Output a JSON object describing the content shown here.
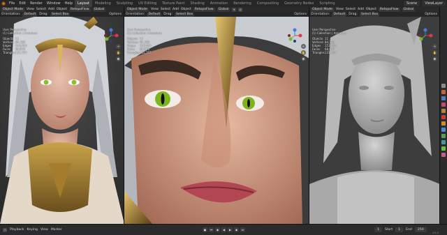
{
  "topbar": {
    "menus": [
      "File",
      "Edit",
      "Render",
      "Window",
      "Help"
    ],
    "workspaces": [
      "Layout",
      "Modeling",
      "Sculpting",
      "UV Editing",
      "Texture Paint",
      "Shading",
      "Animation",
      "Rendering",
      "Compositing",
      "Geometry Nodes",
      "Scripting"
    ],
    "active_workspace": "Layout",
    "scene": "Scene",
    "view_layer": "ViewLayer"
  },
  "viewports": [
    {
      "mode": "Object Mode",
      "menus": [
        "View",
        "Select",
        "Add",
        "Object"
      ],
      "retopo": "RetopoFlow",
      "orientation_label": "Orientation:",
      "orientation_value": "Default",
      "drag_label": "Drag:",
      "drag_value": "Select Box",
      "options": "Options",
      "transform": "Global",
      "view_name": "User Perspective",
      "collection": "(1) Collection | Armature",
      "stats": [
        {
          "label": "Objects",
          "value": "11"
        },
        {
          "label": "Vertices",
          "value": "84,158"
        },
        {
          "label": "Edges",
          "value": "153,453"
        },
        {
          "label": "Faces",
          "value": "68,870"
        },
        {
          "label": "Triangles",
          "value": "131,757"
        }
      ]
    },
    {
      "mode": "Object Mode",
      "menus": [
        "View",
        "Select",
        "Add",
        "Object"
      ],
      "retopo": "RetopoFlow",
      "orientation_label": "Orientation:",
      "orientation_value": "Default",
      "drag_label": "Drag:",
      "drag_value": "Select Box",
      "options": "Options",
      "transform": "Global",
      "view_name": "User Perspective",
      "collection": "(1) Collection | Armature",
      "stats": [
        {
          "label": "Objects",
          "value": "11"
        },
        {
          "label": "Vertices",
          "value": "84,158"
        },
        {
          "label": "Edges",
          "value": "153,453"
        },
        {
          "label": "Faces",
          "value": "68,870"
        },
        {
          "label": "Triangles",
          "value": "131,757"
        }
      ]
    },
    {
      "mode": "Object Mode",
      "menus": [
        "View",
        "Select",
        "Add",
        "Object"
      ],
      "retopo": "RetopoFlow",
      "orientation_label": "Orientation:",
      "orientation_value": "Default",
      "drag_label": "Drag:",
      "drag_value": "Select Box",
      "options": "Options",
      "transform": "Global",
      "view_name": "User Perspective",
      "collection": "(1) Collection | Armature",
      "stats": [
        {
          "label": "Objects",
          "value": "11"
        },
        {
          "label": "Vertices",
          "value": "84,158"
        },
        {
          "label": "Edges",
          "value": "153,453"
        },
        {
          "label": "Faces",
          "value": "68,870"
        },
        {
          "label": "Triangles",
          "value": "131,757"
        }
      ]
    }
  ],
  "timeline": {
    "playback": "Playback",
    "keying": "Keying",
    "view": "View",
    "marker": "Marker",
    "current_frame": "1",
    "start_label": "Start",
    "start": "1",
    "end_label": "End",
    "end": "250",
    "version": "3.6.0"
  },
  "colors": {
    "accent": "#4772b3",
    "logo": "#e87d0d",
    "x_axis": "#e0364c",
    "y_axis": "#76b531",
    "z_axis": "#3e7fdf"
  }
}
